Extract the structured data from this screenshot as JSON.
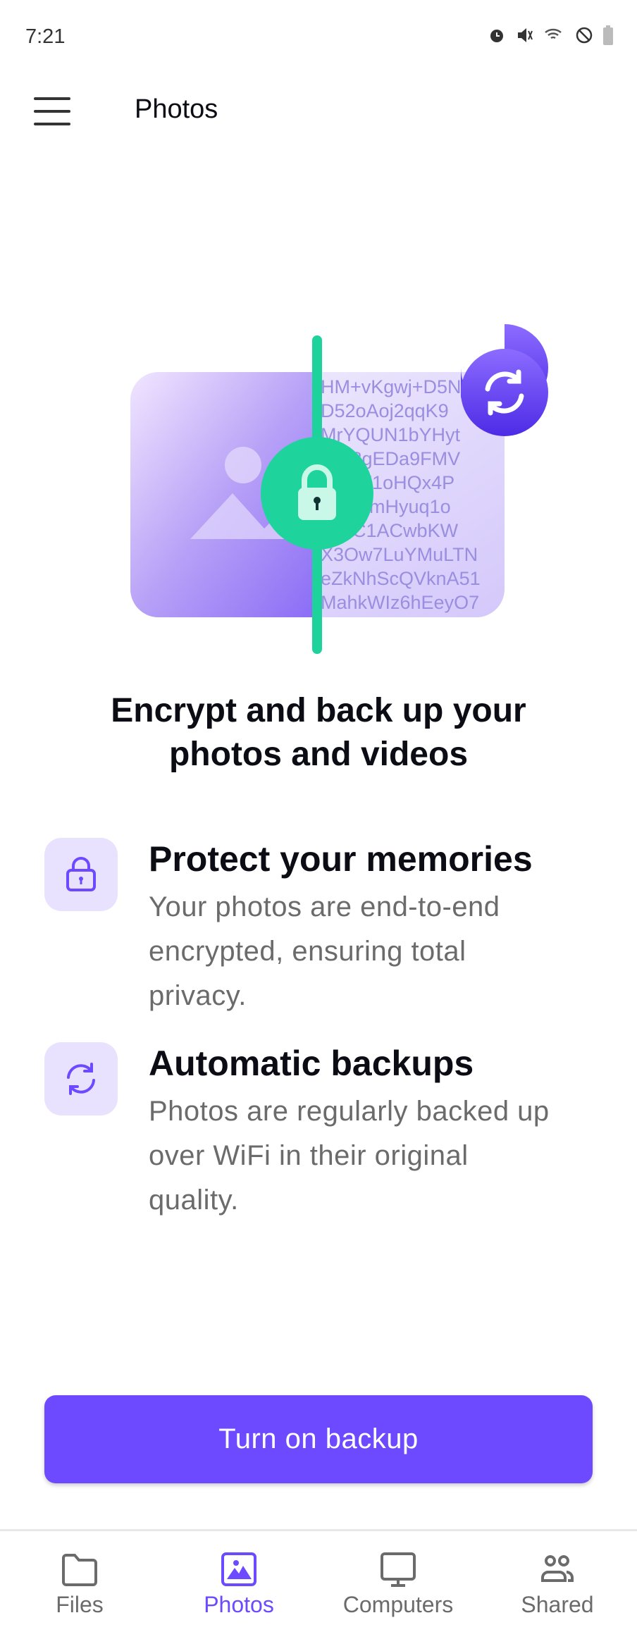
{
  "status_bar": {
    "time": "7:21",
    "icons": [
      "sync-icon",
      "alarm-icon",
      "mute-icon",
      "wifi-icon",
      "do-not-disturb-icon",
      "battery-icon"
    ]
  },
  "header": {
    "title": "Photos",
    "menu_icon": "hamburger-icon"
  },
  "illustration": {
    "cipher_lines": [
      "HM+vKgwj+D5N",
      "D52oAoj2qqK9",
      "MrYQUN1bYHyt",
      "  0k8gEDa9FMV",
      "  YfaY1oHQx4P",
      "  34ramHyuq1o",
      "  guC1ACwbKW",
      "X3Ow7LuYMuLTN",
      "eZkNhScQVknA51",
      "MahkWIz6hEeyO7"
    ]
  },
  "heading": {
    "line1": "Encrypt and back up your",
    "line2": "photos and videos"
  },
  "features": [
    {
      "icon": "lock-icon",
      "title": "Protect your memories",
      "desc": [
        "Your photos are end-to-end",
        "encrypted, ensuring total",
        "privacy."
      ]
    },
    {
      "icon": "sync-icon",
      "title": "Automatic backups",
      "desc": [
        "Photos are regularly backed up",
        "over WiFi in their original",
        "quality."
      ]
    }
  ],
  "button": {
    "label": "Turn on backup"
  },
  "nav": {
    "items": [
      {
        "label": "Files",
        "icon": "folder-icon"
      },
      {
        "label": "Photos",
        "icon": "photo-icon",
        "active": true
      },
      {
        "label": "Computers",
        "icon": "monitor-icon"
      },
      {
        "label": "Shared",
        "icon": "users-icon"
      }
    ]
  },
  "colors": {
    "accent": "#6d4aff",
    "green": "#1dd39b",
    "icon_bg": "#e9e2fe"
  }
}
